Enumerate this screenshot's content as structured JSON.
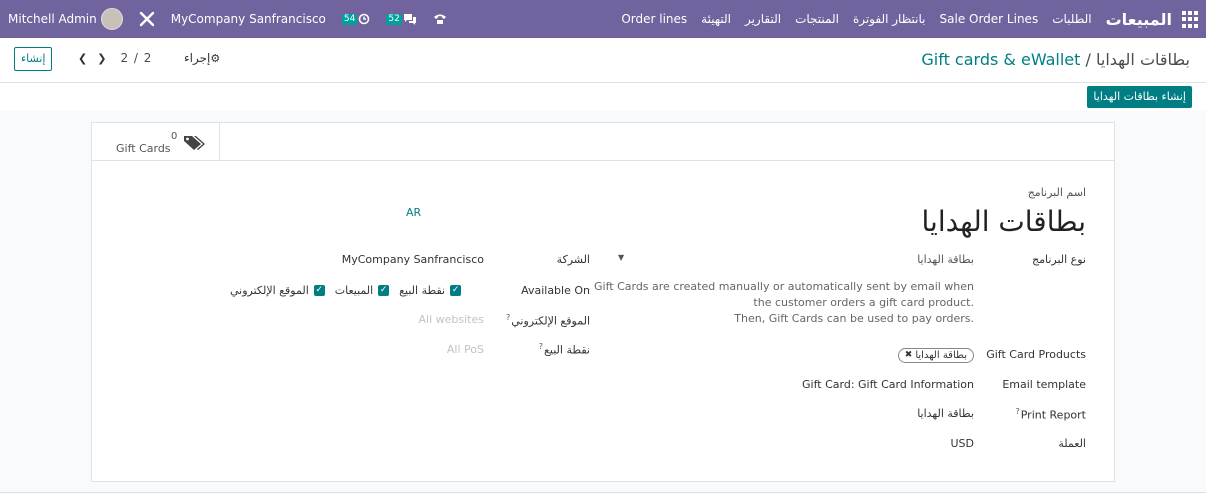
{
  "navbar": {
    "app_name": "المبيعات",
    "menu": [
      "الطلبات",
      "Sale Order Lines",
      "بانتظار الفوترة",
      "المنتجات",
      "التقارير",
      "التهيئة",
      "Order lines"
    ],
    "activity_count": "54",
    "messages_count": "52",
    "company": "MyCompany Sanfrancisco",
    "user": "Mitchell Admin",
    "icons": [
      "apps-grid-icon",
      "phone-icon",
      "chat-icon",
      "clock-icon",
      "debug-tools-icon"
    ],
    "color": "#71639e"
  },
  "control_panel": {
    "breadcrumb_parent": "Gift cards & eWallet",
    "breadcrumb_separator": "/",
    "breadcrumb_current": "بطاقات الهدايا",
    "create_label": "إنشاء",
    "pager": "2 / 2",
    "action_label": "إجراء",
    "generate_button": "إنشاء بطاقات الهدايا",
    "accent": "#017e84"
  },
  "stat_button": {
    "value": "0",
    "label": "Gift Cards"
  },
  "form": {
    "name_label": "اسم البرنامج",
    "name": "بطاقات الهدايا",
    "lang": "AR",
    "program_type_label": "نوع البرنامج",
    "program_type": "بطاقة الهدايا",
    "help_lines": [
      "Gift Cards are created manually or automatically sent by email when",
      "the customer orders a gift card product.",
      "Then, Gift Cards can be used to pay orders."
    ],
    "products_label": "Gift Card Products",
    "products_tag": "بطاقة الهدايا",
    "email_template_label": "Email template",
    "email_template": "Gift Card: Gift Card Information",
    "print_report_label": "Print Report",
    "print_report": "بطاقة الهدايا",
    "currency_label": "العملة",
    "currency": "USD",
    "company_label": "الشركة",
    "company": "MyCompany Sanfrancisco",
    "available_on_label": "Available On",
    "available_on": [
      "نقطة البيع",
      "المبيعات",
      "الموقع الإلكتروني"
    ],
    "website_label": "الموقع الإلكتروني",
    "website_placeholder": "All websites",
    "pos_label": "نقطة البيع",
    "pos_placeholder": "All PoS",
    "help_marker": "?"
  }
}
